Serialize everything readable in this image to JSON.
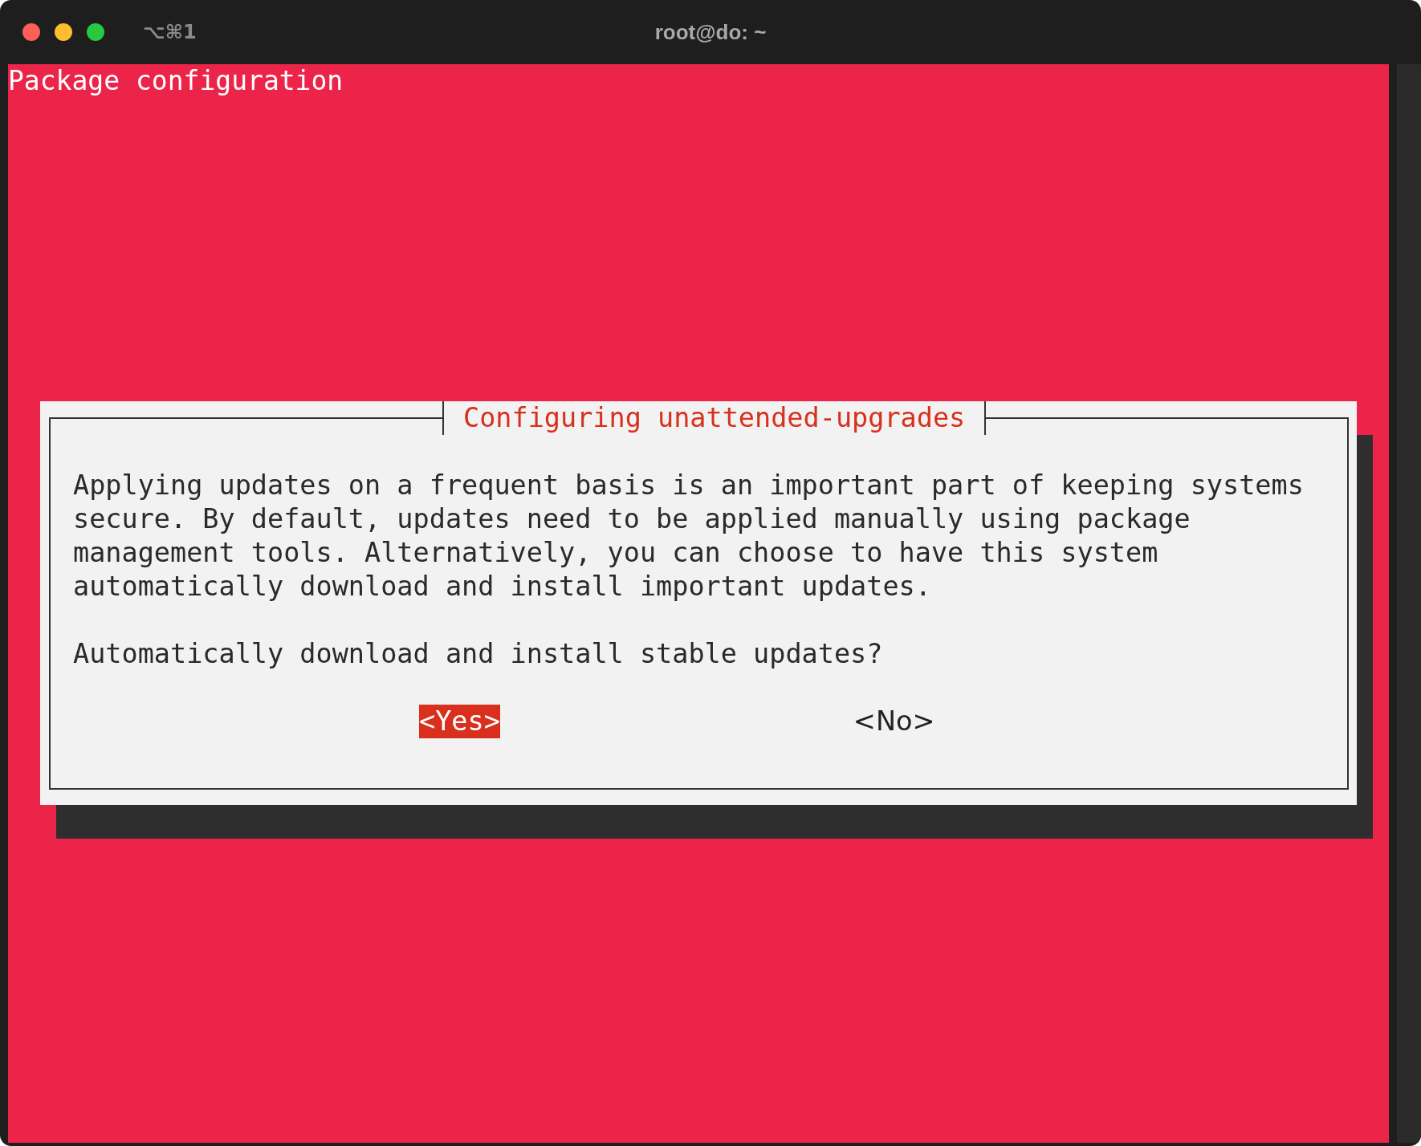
{
  "window": {
    "title": "root@do: ~",
    "shortcut": "⌥⌘1"
  },
  "terminal": {
    "header": "Package configuration"
  },
  "dialog": {
    "title": "Configuring unattended-upgrades",
    "paragraphs": [
      "Applying updates on a frequent basis is an important part of keeping systems secure. By default, updates need to be applied manually using package management tools. Alternatively, you can choose to have this system automatically download and install important updates.",
      "Automatically download and install stable updates?"
    ],
    "buttons": [
      {
        "label": "<Yes>",
        "selected": true
      },
      {
        "label": "<No>",
        "selected": false
      }
    ]
  }
}
